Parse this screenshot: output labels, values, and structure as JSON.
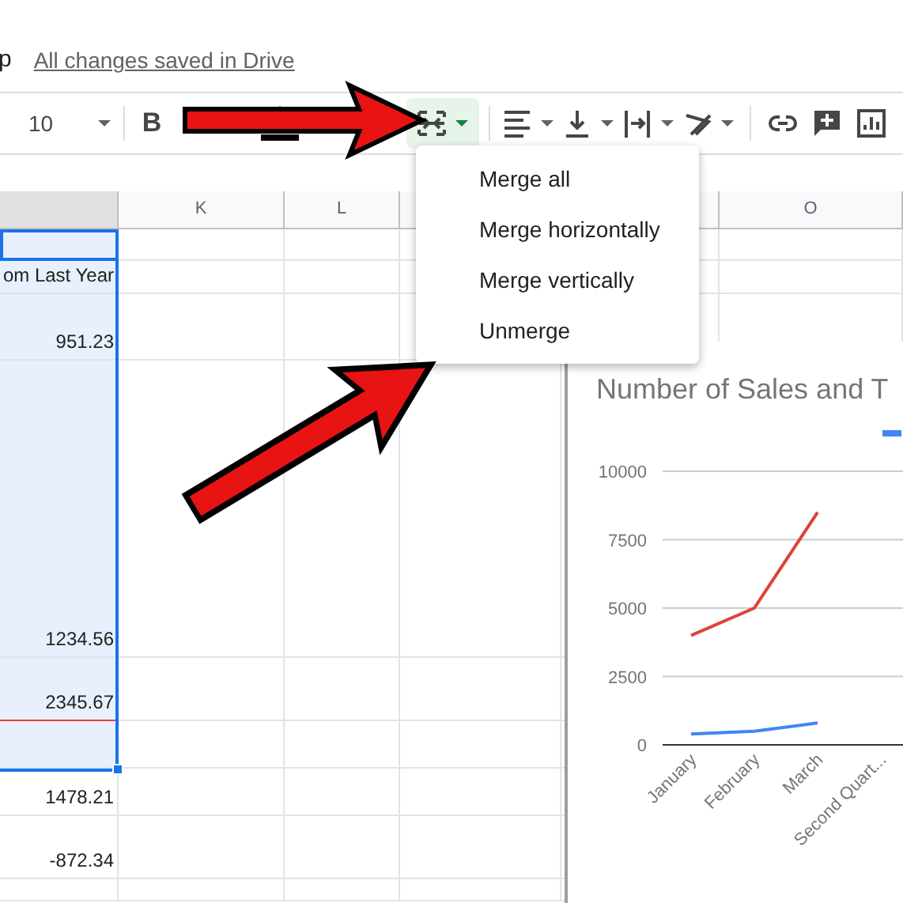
{
  "header": {
    "menu_fragment": "p",
    "save_status": "All changes saved in Drive"
  },
  "toolbar": {
    "items": [
      {
        "kind": "font_size",
        "value": "10"
      },
      {
        "kind": "divider"
      },
      {
        "kind": "bold",
        "label": "B"
      },
      {
        "kind": "text_color"
      },
      {
        "kind": "merge",
        "selected": true
      },
      {
        "kind": "divider"
      },
      {
        "kind": "align"
      },
      {
        "kind": "valign"
      },
      {
        "kind": "wrap"
      },
      {
        "kind": "rotate"
      },
      {
        "kind": "divider"
      },
      {
        "kind": "link"
      },
      {
        "kind": "comment"
      },
      {
        "kind": "chart"
      }
    ]
  },
  "merge_menu": {
    "items": [
      {
        "label": "Merge all"
      },
      {
        "label": "Merge horizontally"
      },
      {
        "label": "Merge vertically"
      },
      {
        "label": "Unmerge"
      }
    ]
  },
  "sheet": {
    "columns": [
      {
        "selected": true
      },
      {
        "label": "K",
        "selected": false
      },
      {
        "label": "L",
        "selected": false
      },
      {
        "selected": false
      },
      {
        "selected": false
      },
      {
        "label": "O",
        "selected": false
      }
    ],
    "rows": [
      {
        "selected": true,
        "active": true
      },
      {
        "value": "om Last Year",
        "selected": true,
        "active": false
      },
      {
        "value": "951.23",
        "selected": true,
        "active": false
      },
      {
        "value": "1234.56",
        "selected": true,
        "active": false
      },
      {
        "value": "2345.67",
        "selected": true,
        "active": false
      },
      {
        "selected": true,
        "active": false
      },
      {
        "value": "1478.21",
        "selected": false,
        "active": false
      },
      {
        "value": "-872.34",
        "selected": false,
        "active": false
      },
      {
        "selected": false,
        "active": false
      }
    ]
  },
  "chart": {
    "chart_data": {
      "type": "line",
      "title": "Number of Sales and T",
      "categories": [
        "January",
        "February",
        "March",
        "Second Quart..."
      ],
      "series": [
        {
          "color": "#db4437",
          "values": [
            4000,
            5000,
            8500,
            null
          ]
        },
        {
          "color": "#4285f4",
          "values": [
            400,
            500,
            800,
            null
          ]
        }
      ],
      "ylim": [
        0,
        10000
      ],
      "grid": true,
      "yticks": [
        0,
        2500,
        5000,
        7500,
        10000
      ]
    }
  }
}
